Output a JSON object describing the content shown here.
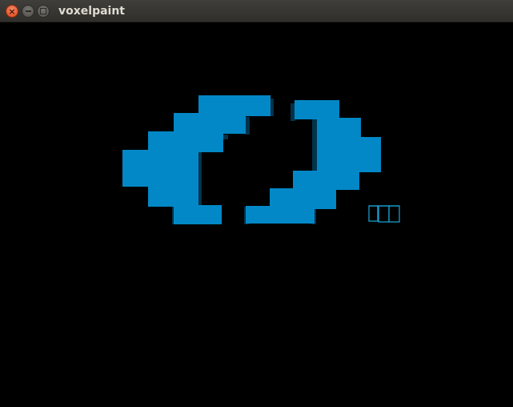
{
  "window": {
    "title": "voxelpaint",
    "buttons": {
      "close": "close-icon",
      "minimize": "minimize-icon",
      "maximize": "maximize-icon"
    }
  },
  "colors": {
    "titlebar": "#3a3935",
    "title_text": "#dfdbd2",
    "canvas": "#000000",
    "voxel_face": "#0288c7",
    "voxel_shadow": "#02324a",
    "cursor": "#1aa6d6"
  }
}
